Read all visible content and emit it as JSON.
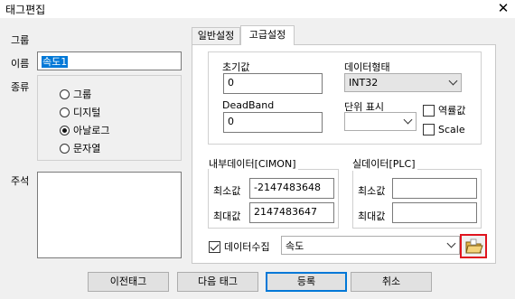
{
  "window": {
    "title": "태그편집",
    "close_glyph": "✕"
  },
  "left": {
    "group_label": "그룹",
    "name_label": "이름",
    "name_value": "속도1",
    "type_label": "종류",
    "type_options": [
      {
        "label": "그룹",
        "checked": false
      },
      {
        "label": "디지털",
        "checked": false
      },
      {
        "label": "아날로그",
        "checked": true
      },
      {
        "label": "문자열",
        "checked": false
      }
    ],
    "comment_label": "주석",
    "comment_value": ""
  },
  "tabs": [
    {
      "label": "일반설정",
      "active": false
    },
    {
      "label": "고급설정",
      "active": true
    }
  ],
  "advanced": {
    "initial_label": "초기값",
    "initial_value": "0",
    "datatype_label": "데이터형태",
    "datatype_value": "INT32",
    "deadband_label": "DeadBand",
    "deadband_value": "0",
    "unit_label": "단위 표시",
    "unit_value": "",
    "reverse_label": "역률값",
    "scale_label": "Scale",
    "internal_group": "내부데이터[CIMON]",
    "internal_min_label": "최소값",
    "internal_min_value": "-2147483648",
    "internal_max_label": "최대값",
    "internal_max_value": "2147483647",
    "real_group": "실데이터[PLC]",
    "real_min_label": "최소값",
    "real_min_value": "",
    "real_max_label": "최대값",
    "real_max_value": "",
    "collect_label": "데이터수집",
    "collect_checked": true,
    "collect_value": "속도"
  },
  "buttons": {
    "prev": "이전태그",
    "next": "다음 태그",
    "register": "등록",
    "cancel": "취소"
  },
  "colors": {
    "highlight_border": "#e0141e",
    "selection": "#0078d7"
  }
}
